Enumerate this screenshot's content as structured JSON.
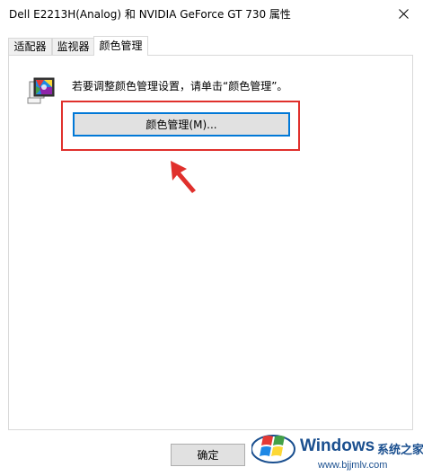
{
  "window": {
    "title": "Dell E2213H(Analog) 和 NVIDIA GeForce GT 730 属性"
  },
  "tabs": [
    {
      "label": "适配器"
    },
    {
      "label": "监视器"
    },
    {
      "label": "颜色管理"
    }
  ],
  "active_tab": "颜色管理",
  "panel": {
    "description": "若要调整颜色管理设置，请单击“颜色管理”。",
    "color_management_button": "颜色管理(M)..."
  },
  "footer": {
    "ok_button": "确定"
  },
  "watermark": {
    "brand": "Windows",
    "suffix": "系统之家",
    "url": "www.bjjmlv.com"
  },
  "colors": {
    "highlight": "#e0302c",
    "focus": "#0078d7"
  },
  "icons": [
    "close-icon",
    "monitor-color-icon",
    "red-arrow-icon",
    "windows-logo-icon"
  ]
}
